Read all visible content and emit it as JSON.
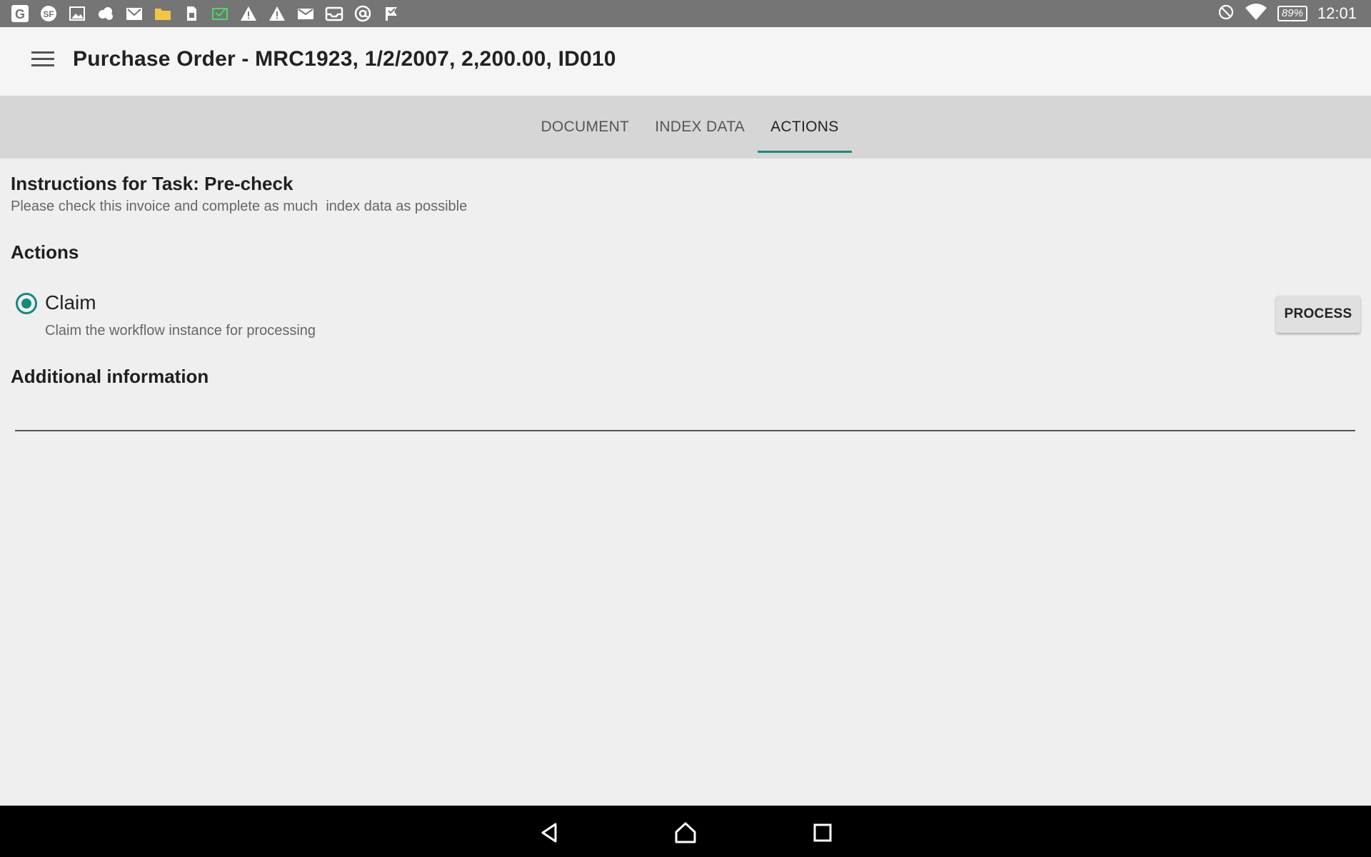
{
  "status_bar": {
    "notification_icons": [
      "google-icon",
      "sf-icon",
      "image-icon",
      "cloud-icon",
      "gmail-icon",
      "folder-icon",
      "sim-icon",
      "mail-check-icon",
      "warning-icon",
      "warning-icon",
      "envelope-icon",
      "inbox-icon",
      "at-icon",
      "flag-check-icon"
    ],
    "battery": "89%",
    "time": "12:01"
  },
  "app_bar": {
    "title": "Purchase Order - MRC1923, 1/2/2007, 2,200.00, ID010"
  },
  "tabs": [
    {
      "label": "DOCUMENT",
      "active": false
    },
    {
      "label": "INDEX DATA",
      "active": false
    },
    {
      "label": "ACTIONS",
      "active": true
    }
  ],
  "content": {
    "task_title": "Instructions for Task: Pre-check",
    "task_description": "Please check this invoice and complete as much  index data as possible",
    "actions_heading": "Actions",
    "action_option": {
      "label": "Claim",
      "description": "Claim the workflow instance for processing",
      "selected": true
    },
    "process_button": "PROCESS",
    "additional_heading": "Additional information",
    "additional_value": ""
  },
  "colors": {
    "accent": "#138a80",
    "status_bar": "#757575",
    "tab_bar": "#d6d6d6"
  }
}
